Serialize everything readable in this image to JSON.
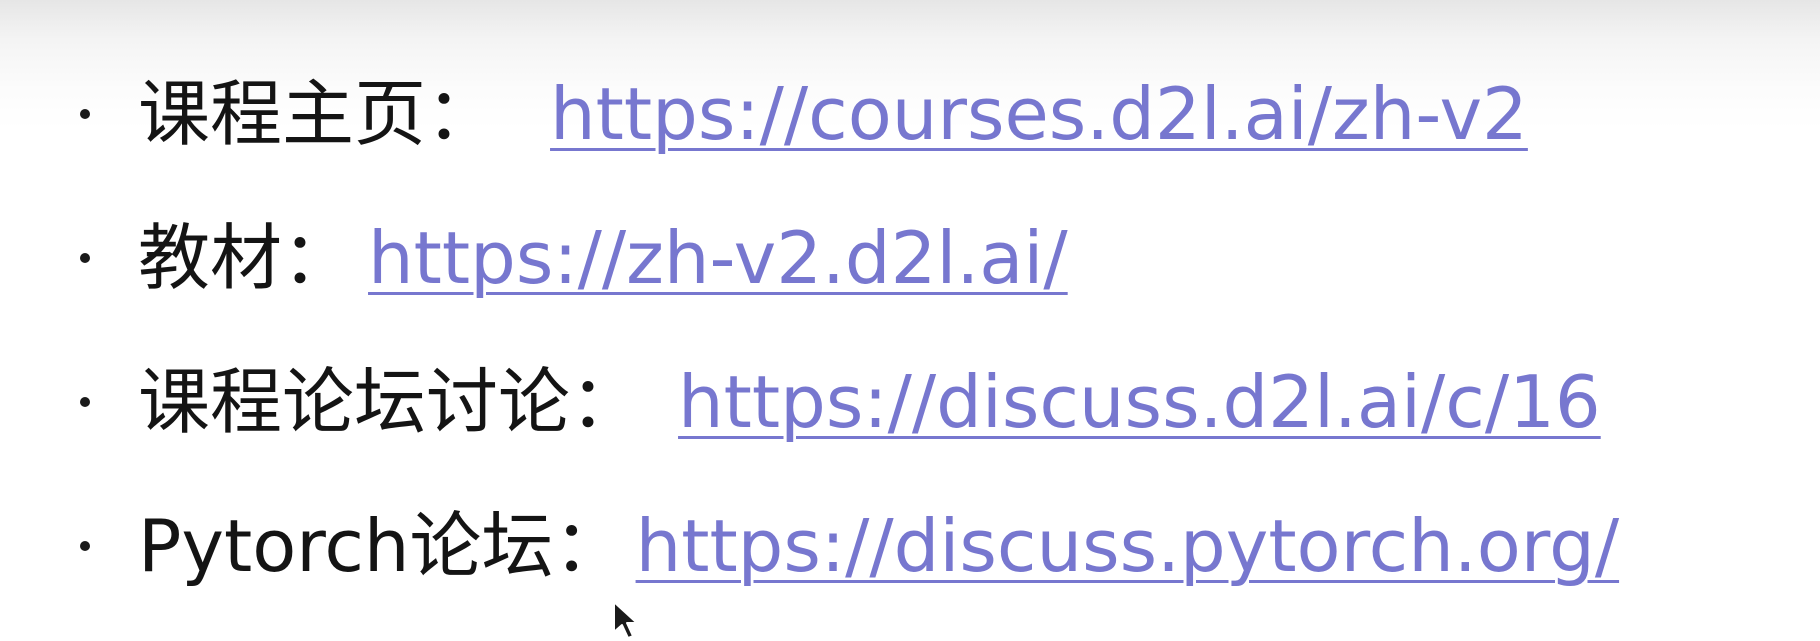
{
  "slide": {
    "items": [
      {
        "label": "课程主页",
        "colon": "：",
        "url": "https://courses.d2l.ai/zh-v2"
      },
      {
        "label": "教材",
        "colon": "：",
        "url": "https://zh-v2.d2l.ai/"
      },
      {
        "label": "课程论坛讨论",
        "colon": "：",
        "url": "https://discuss.d2l.ai/c/16"
      },
      {
        "label": "Pytorch论坛",
        "colon": "：",
        "url": "https://discuss.pytorch.org/"
      }
    ]
  },
  "cursor": {
    "icon": "mouse-pointer-icon"
  },
  "colors": {
    "link": "#7777cf",
    "text": "#141414",
    "background_top": "#e6e6e6",
    "background": "#ffffff"
  }
}
